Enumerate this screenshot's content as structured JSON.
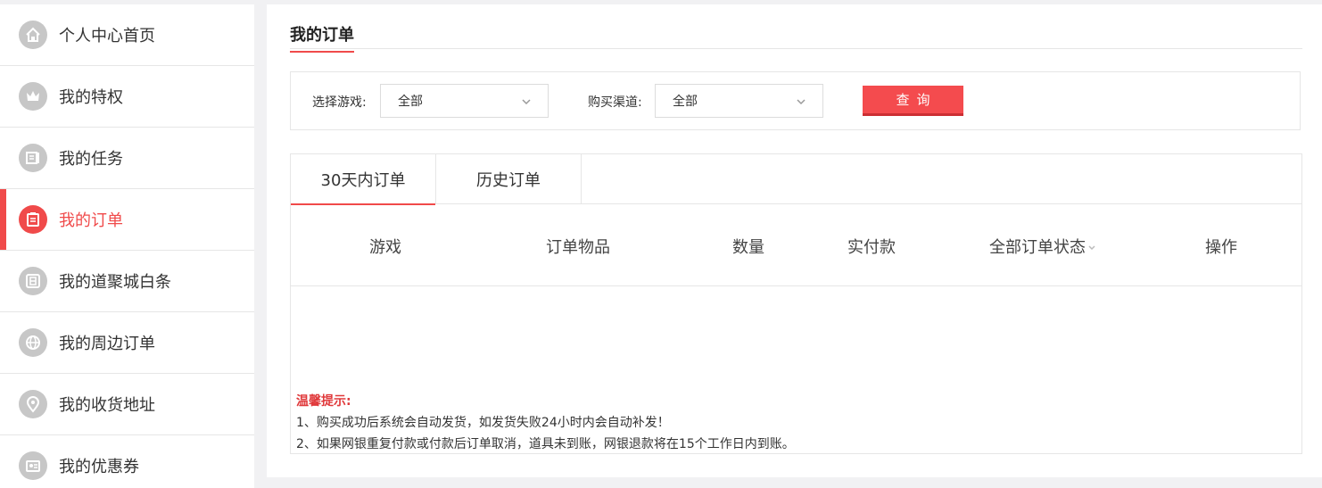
{
  "sidebar": {
    "items": [
      {
        "label": "个人中心首页",
        "icon": "home-icon"
      },
      {
        "label": "我的特权",
        "icon": "crown-icon"
      },
      {
        "label": "我的任务",
        "icon": "task-list-icon"
      },
      {
        "label": "我的订单",
        "icon": "order-clipboard-icon",
        "active": true
      },
      {
        "label": "我的道聚城白条",
        "icon": "credit-bai-icon"
      },
      {
        "label": "我的周边订单",
        "icon": "globe-icon"
      },
      {
        "label": "我的收货地址",
        "icon": "location-pin-icon"
      },
      {
        "label": "我的优惠券",
        "icon": "coupon-icon"
      }
    ]
  },
  "main": {
    "title": "我的订单",
    "filters": {
      "game_label": "选择游戏:",
      "game_value": "全部",
      "channel_label": "购买渠道:",
      "channel_value": "全部",
      "query_label": "查询"
    },
    "tabs": [
      {
        "label": "30天内订单",
        "active": true
      },
      {
        "label": "历史订单",
        "active": false
      }
    ],
    "columns": [
      "游戏",
      "订单物品",
      "数量",
      "实付款",
      "全部订单状态",
      "操作"
    ],
    "tips": {
      "title": "温馨提示:",
      "lines": [
        "1、购买成功后系统会自动发货，如发货失败24小时内会自动补发！",
        "2、如果网银重复付款或付款后订单取消，道具未到账，网银退款将在15个工作日内到账。"
      ]
    }
  },
  "colors": {
    "accent": "#f04a4a",
    "button": "#f44b4e",
    "icon_inactive": "#c7c7c7"
  }
}
